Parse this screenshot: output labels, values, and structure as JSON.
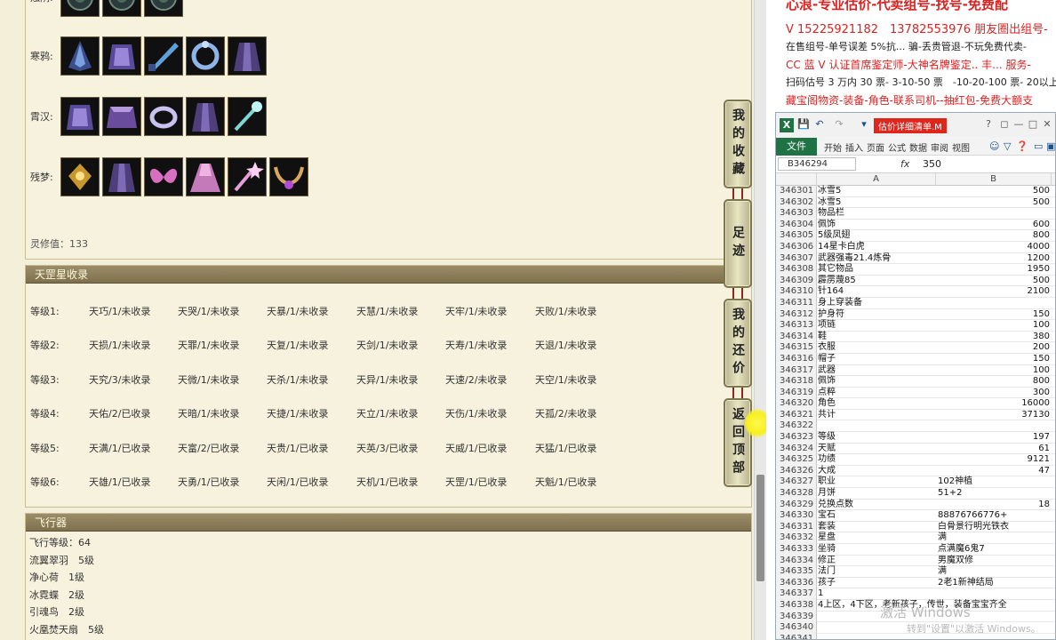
{
  "game": {
    "equip_rows": [
      {
        "label": "烛阴:",
        "icons": [
          "dark-gem-icon",
          "dark-gem-icon",
          "dark-gem-icon"
        ]
      },
      {
        "label": "寒鸦:",
        "icons": [
          "cloak-icon",
          "armor-icon",
          "blade-icon",
          "ring-icon",
          "robe-icon"
        ]
      },
      {
        "label": "霄汉:",
        "icons": [
          "armor-icon",
          "skirt-icon",
          "bracelet-icon",
          "robe-icon",
          "staff-icon"
        ]
      },
      {
        "label": "残梦:",
        "icons": [
          "charm-icon",
          "robe-icon",
          "butterfly-icon",
          "dress-icon",
          "wand-icon",
          "necklace-icon"
        ]
      }
    ],
    "cultivation": "灵修值：133",
    "tiangang_title": "天罡星收录",
    "tiangang_rows": [
      {
        "level": "等级1:",
        "stars": [
          "天巧/1/未收录",
          "天哭/1/未收录",
          "天暴/1/未收录",
          "天慧/1/未收录",
          "天牢/1/未收录",
          "天败/1/未收录"
        ]
      },
      {
        "level": "等级2:",
        "stars": [
          "天损/1/未收录",
          "天罪/1/未收录",
          "天复/1/未收录",
          "天剑/1/未收录",
          "天寿/1/未收录",
          "天退/1/未收录"
        ]
      },
      {
        "level": "等级3:",
        "stars": [
          "天究/3/未收录",
          "天微/1/未收录",
          "天杀/1/未收录",
          "天异/1/未收录",
          "天速/2/未收录",
          "天空/1/未收录"
        ]
      },
      {
        "level": "等级4:",
        "stars": [
          "天佑/2/已收录",
          "天暗/1/未收录",
          "天捷/1/未收录",
          "天立/1/未收录",
          "天伤/1/未收录",
          "天孤/2/未收录"
        ]
      },
      {
        "level": "等级5:",
        "stars": [
          "天满/1/已收录",
          "天富/2/已收录",
          "天贵/1/已收录",
          "天英/3/已收录",
          "天威/1/已收录",
          "天猛/1/已收录"
        ]
      },
      {
        "level": "等级6:",
        "stars": [
          "天雄/1/已收录",
          "天勇/1/已收录",
          "天闲/1/已收录",
          "天机/1/已收录",
          "天罡/1/已收录",
          "天魁/1/已收录"
        ]
      }
    ],
    "fly_title": "飞行器",
    "fly_lines": [
      "飞行等级：64",
      "流翼翠羽　5级",
      "净心荷　1级",
      "冰霓蝶　2级",
      "引魂鸟　2级",
      "火凰焚天扇　5级"
    ],
    "side_buttons": [
      "我的收藏",
      "足迹",
      "我的还价",
      "返回顶部"
    ],
    "scroll_fraction": 0.89
  },
  "ads": {
    "line1": "心浪-专业估价-代卖组号-找号-免费配",
    "line2": "V 15225921182　13782553976 朋友圈出组号-",
    "line3": "在售组号-单号误差 5%抗... 骗-丢贵管退-不玩免费代卖-",
    "line4": "CC 蓝 V 认证首席鉴定师-大神名牌鉴定.. 丰... 服务-",
    "line5": "扫码估号 3 万内 30 票- 3-10-50 票　-10-20-100 票- 20以上 150",
    "line6": "藏宝阁物资-装备-角色-联系司机--抽红包-免费大额支"
  },
  "excel": {
    "file_name": "估价详细清单.M",
    "logo": "X",
    "file_tab": "文件",
    "ribbon_tabs": [
      "开始",
      "插入",
      "页面",
      "公式",
      "数据",
      "审阅",
      "视图"
    ],
    "name_box": "B346294",
    "fx": "fx",
    "formula_value": "350",
    "col_a": "A",
    "col_b": "B",
    "rows": [
      [
        "346301",
        "冰雪5",
        "500"
      ],
      [
        "346302",
        "冰雪5",
        "500"
      ],
      [
        "346303",
        "物品栏",
        ""
      ],
      [
        "346304",
        "佩饰",
        "600"
      ],
      [
        "346305",
        "5级凤翅",
        "800"
      ],
      [
        "346306",
        "14星卡白虎",
        "4000"
      ],
      [
        "346307",
        "武器强毒21.4炼骨",
        "1200"
      ],
      [
        "346308",
        "其它物品",
        "1950"
      ],
      [
        "346309",
        "霹雳蔑85",
        "500"
      ],
      [
        "346310",
        "针164",
        "2100"
      ],
      [
        "346311",
        "身上穿装备",
        ""
      ],
      [
        "346312",
        "护身符",
        "150"
      ],
      [
        "346313",
        "项链",
        "100"
      ],
      [
        "346314",
        "鞋",
        "380"
      ],
      [
        "346315",
        "衣服",
        "200"
      ],
      [
        "346316",
        "帽子",
        "150"
      ],
      [
        "346317",
        "武器",
        "100"
      ],
      [
        "346318",
        "佩饰",
        "800"
      ],
      [
        "346319",
        "点粹",
        "300"
      ],
      [
        "346320",
        "角色",
        "16000"
      ],
      [
        "346321",
        "共计",
        "37130"
      ],
      [
        "346322",
        "",
        ""
      ],
      [
        "346323",
        "等级",
        "197"
      ],
      [
        "346324",
        "天赋",
        "61"
      ],
      [
        "346325",
        "功绩",
        "9121"
      ],
      [
        "346326",
        "大成",
        "47"
      ],
      [
        "346327",
        "职业",
        "102神植"
      ],
      [
        "346328",
        "月饼",
        "51+2"
      ],
      [
        "346329",
        "兑换点数",
        "18"
      ],
      [
        "346330",
        "宝石",
        "88876766776+"
      ],
      [
        "346331",
        "套装",
        "白骨景行明光铁衣"
      ],
      [
        "346332",
        "星盘",
        "满"
      ],
      [
        "346333",
        "坐骑",
        "点满魔6鬼7"
      ],
      [
        "346334",
        "修正",
        "男魔双修"
      ],
      [
        "346335",
        "法门",
        "满"
      ],
      [
        "346336",
        "孩子",
        "2老1新神结局"
      ],
      [
        "346337",
        "1",
        ""
      ],
      [
        "346338",
        "4上区，4下区，老新孩子，传世，装备宝宝齐全",
        ""
      ],
      [
        "346339",
        "",
        ""
      ],
      [
        "346340",
        "",
        ""
      ],
      [
        "346341",
        "",
        ""
      ]
    ]
  },
  "watermark": "激活 Windows",
  "watermark_sub": "转到\"设置\"以激活 Windows。"
}
